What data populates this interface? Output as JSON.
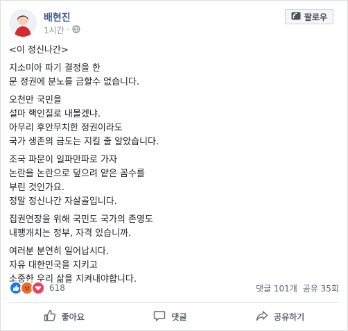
{
  "header": {
    "author": "배현진",
    "time": "1시간",
    "follow_label": "팔로우"
  },
  "body": {
    "paragraphs": [
      [
        "<이 정신나간>"
      ],
      [
        "지소미아 파기 결정을 한",
        "문 정권에 분노를 금할수 없습니다."
      ],
      [
        "오천만 국민을",
        "설마 핵인질로 내몰겠냐.",
        "아무리 후안무치한 정권이라도",
        "국가 생존의 금도는 지킬 줄 알았습니다."
      ],
      [
        "조국 파문이 일파만파로 가자",
        "논란을 논란으로 덮으려 얕은 꼼수를",
        "부린 것인가요.",
        "정말 정신나간 자살골입니다."
      ],
      [
        "집권연장을 위해 국민도 국가의 존영도",
        "내팽개치는 정부, 자격 있습니까."
      ],
      [
        "여러분 분연히 일어납시다.",
        "자유 대한민국을 지키고",
        "소중한 우리 삶을 지켜내야합니다."
      ]
    ]
  },
  "stats": {
    "reaction_count": "618",
    "comments": "댓글 101개",
    "shares": "공유 35회"
  },
  "actions": {
    "like": "좋아요",
    "comment": "댓글",
    "share": "공유하기"
  },
  "colors": {
    "like_blue": "#1877f2",
    "angry_orange": "#f0692a",
    "love_red": "#f33e58",
    "link_blue": "#365899"
  },
  "icons": {
    "globe": "globe-icon",
    "follow": "follow-icon",
    "like": "thumbs-up-icon",
    "comment": "comment-icon",
    "share": "share-icon"
  }
}
